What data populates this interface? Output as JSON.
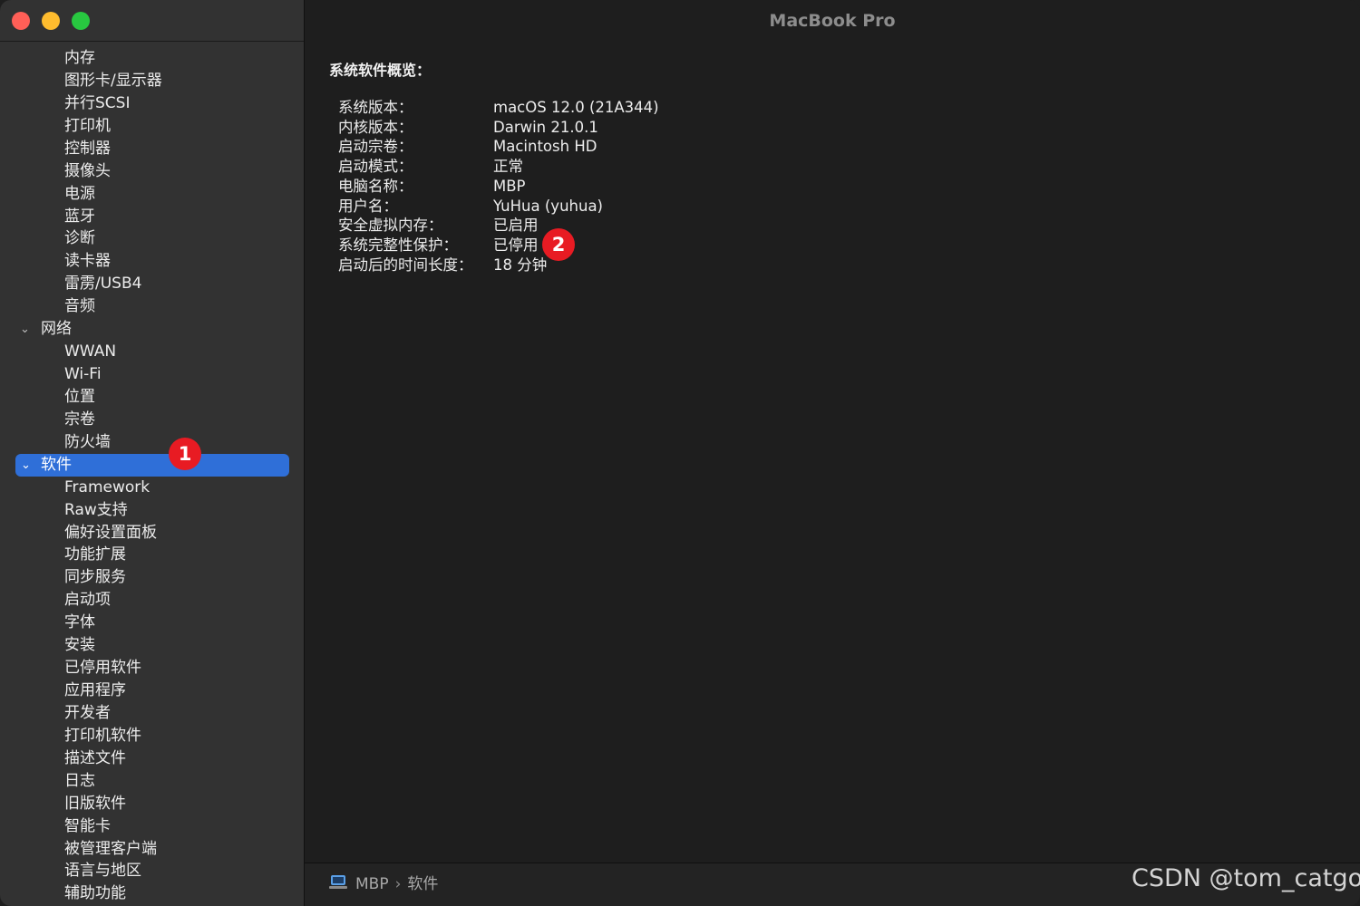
{
  "window": {
    "title": "MacBook Pro"
  },
  "sidebar": {
    "items": [
      {
        "label": "内存",
        "level": "child"
      },
      {
        "label": "图形卡/显示器",
        "level": "child"
      },
      {
        "label": "并行SCSI",
        "level": "child"
      },
      {
        "label": "打印机",
        "level": "child"
      },
      {
        "label": "控制器",
        "level": "child"
      },
      {
        "label": "摄像头",
        "level": "child"
      },
      {
        "label": "电源",
        "level": "child"
      },
      {
        "label": "蓝牙",
        "level": "child"
      },
      {
        "label": "诊断",
        "level": "child"
      },
      {
        "label": "读卡器",
        "level": "child"
      },
      {
        "label": "雷雳/USB4",
        "level": "child"
      },
      {
        "label": "音频",
        "level": "child"
      },
      {
        "label": "网络",
        "level": "parent"
      },
      {
        "label": "WWAN",
        "level": "child"
      },
      {
        "label": "Wi-Fi",
        "level": "child"
      },
      {
        "label": "位置",
        "level": "child"
      },
      {
        "label": "宗卷",
        "level": "child"
      },
      {
        "label": "防火墙",
        "level": "child"
      },
      {
        "label": "软件",
        "level": "parent",
        "selected": true
      },
      {
        "label": "Framework",
        "level": "child"
      },
      {
        "label": "Raw支持",
        "level": "child"
      },
      {
        "label": "偏好设置面板",
        "level": "child"
      },
      {
        "label": "功能扩展",
        "level": "child"
      },
      {
        "label": "同步服务",
        "level": "child"
      },
      {
        "label": "启动项",
        "level": "child"
      },
      {
        "label": "字体",
        "level": "child"
      },
      {
        "label": "安装",
        "level": "child"
      },
      {
        "label": "已停用软件",
        "level": "child"
      },
      {
        "label": "应用程序",
        "level": "child"
      },
      {
        "label": "开发者",
        "level": "child"
      },
      {
        "label": "打印机软件",
        "level": "child"
      },
      {
        "label": "描述文件",
        "level": "child"
      },
      {
        "label": "日志",
        "level": "child"
      },
      {
        "label": "旧版软件",
        "level": "child"
      },
      {
        "label": "智能卡",
        "level": "child"
      },
      {
        "label": "被管理客户端",
        "level": "child"
      },
      {
        "label": "语言与地区",
        "level": "child"
      },
      {
        "label": "辅助功能",
        "level": "child"
      }
    ]
  },
  "main": {
    "section_title": "系统软件概览：",
    "rows": [
      {
        "key": "系统版本：",
        "value": "macOS 12.0 (21A344)"
      },
      {
        "key": "内核版本：",
        "value": "Darwin 21.0.1"
      },
      {
        "key": "启动宗卷：",
        "value": "Macintosh HD"
      },
      {
        "key": "启动模式：",
        "value": "正常"
      },
      {
        "key": "电脑名称：",
        "value": "MBP"
      },
      {
        "key": "用户名：",
        "value": "YuHua (yuhua)"
      },
      {
        "key": "安全虚拟内存：",
        "value": "已启用"
      },
      {
        "key": "系统完整性保护：",
        "value": "已停用"
      },
      {
        "key": "启动后的时间长度：",
        "value": "18 分钟"
      }
    ]
  },
  "statusbar": {
    "icon": "laptop-icon",
    "crumbs": [
      "MBP",
      "软件"
    ],
    "separator": "›"
  },
  "annotations": {
    "badge1": "1",
    "badge2": "2"
  },
  "watermark": "CSDN @tom_catgo",
  "colors": {
    "selection": "#2f6fd8",
    "badge": "#e81b23",
    "close": "#ff5f57",
    "minimize": "#febc2e",
    "maximize": "#28c840"
  },
  "icons": {
    "expanded": "chevron-down-icon"
  }
}
